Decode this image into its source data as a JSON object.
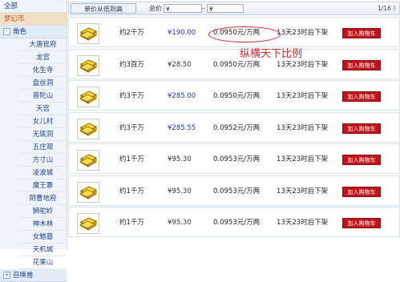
{
  "sidebar": {
    "top_items": [
      {
        "label": "全部",
        "active": false
      },
      {
        "label": "梦幻币",
        "active": true
      }
    ],
    "group": {
      "toggle": "-",
      "label": "角色"
    },
    "items": [
      "大唐官府",
      "龙宫",
      "化生寺",
      "盘丝洞",
      "普陀山",
      "天宫",
      "女儿村",
      "无底洞",
      "五庄观",
      "方寸山",
      "凌波城",
      "魔王寨",
      "阴曹地府",
      "狮驼岭",
      "神木林",
      "女魃墓",
      "天机城",
      "花果山"
    ],
    "bottom_group": {
      "toggle": "+",
      "label": "召唤兽"
    }
  },
  "toolbar": {
    "sort_label": "单价从低到高",
    "total_label": "总价",
    "total_arrow": "▼",
    "min_placeholder": "¥",
    "dash": "-",
    "max_placeholder": "¥",
    "pagination": "1/16 〉"
  },
  "listings": [
    {
      "amount": "约2千万",
      "price": "¥190.00",
      "ratio": "0.0950元/万两",
      "time": "13天23时后下架",
      "button": "加入购物车",
      "price_color": "#2434a8"
    },
    {
      "amount": "约3百万",
      "price": "¥28.50",
      "ratio": "0.0950元/万两",
      "time": "13天23时后下架",
      "button": "加入购物车",
      "price_color": "#333333"
    },
    {
      "amount": "约3千万",
      "price": "¥285.00",
      "ratio": "0.0950元/万两",
      "time": "13天23时后下架",
      "button": "加入购物车",
      "price_color": "#2434a8"
    },
    {
      "amount": "约3千万",
      "price": "¥285.55",
      "ratio": "0.0952元/万两",
      "time": "13天23时后下架",
      "button": "加入购物车",
      "price_color": "#2434a8"
    },
    {
      "amount": "约1千万",
      "price": "¥95.30",
      "ratio": "0.0953元/万两",
      "time": "13天23时后下架",
      "button": "加入购物车",
      "price_color": "#333333"
    },
    {
      "amount": "约1千万",
      "price": "¥95.30",
      "ratio": "0.0953元/万两",
      "time": "13天23时后下架",
      "button": "加入购物车",
      "price_color": "#333333"
    },
    {
      "amount": "约1千万",
      "price": "¥95.30",
      "ratio": "0.0953元/万两",
      "time": "13天23时后下架",
      "button": "加入购物车",
      "price_color": "#333333"
    }
  ],
  "annotation": {
    "text": "纵横天下比例",
    "color": "#d02a2f"
  },
  "colors": {
    "accent_red": "#c0141b",
    "link_blue": "#1d3f8a",
    "gold": "#f2c21a"
  }
}
